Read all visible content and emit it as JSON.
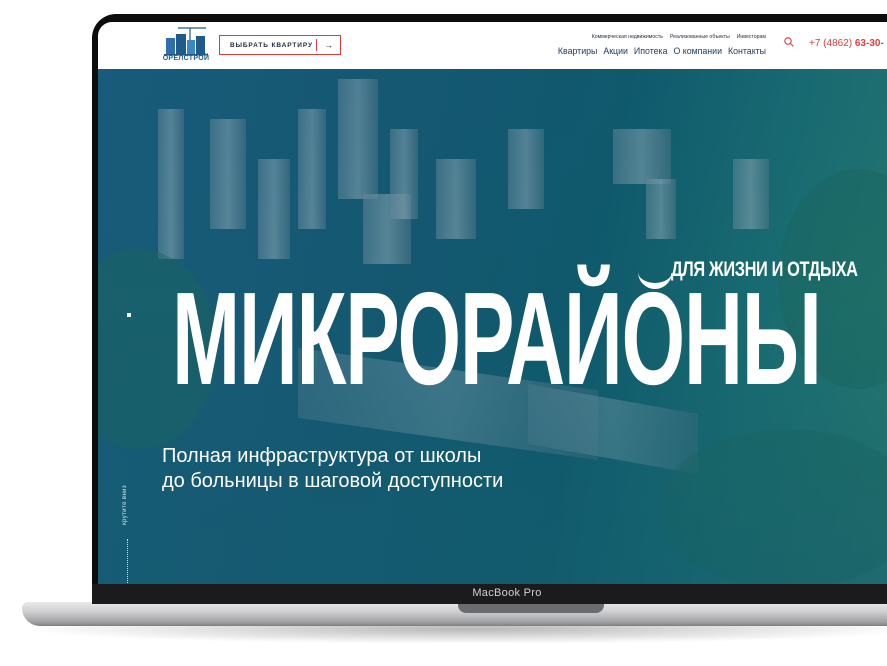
{
  "device": {
    "label": "MacBook Pro"
  },
  "header": {
    "logo_text": "ОРЁЛСТРОЙ",
    "cta_label": "ВЫБРАТЬ КВАРТИРУ",
    "cta_icon": "arrow-right-icon",
    "top_nav": [
      "Коммерческая недвижимость",
      "Реализованные объекты",
      "Инвесторам"
    ],
    "main_nav": [
      "Квартиры",
      "Акции",
      "Ипотека",
      "О компании",
      "Контакты"
    ],
    "phone_prefix": "+7 (4862)",
    "phone_number": "63-30-",
    "search_icon": "search-icon"
  },
  "hero": {
    "subtitle": "ДЛЯ ЖИЗНИ И ОТДЫХА",
    "title": "МИКРОРАЙОНЫ",
    "description_line1": "Полная инфраструктура от школы",
    "description_line2": "до больницы в шаговой доступности",
    "scroll_label": "крутите вниз"
  },
  "colors": {
    "accent": "#e23b3b",
    "brand_blue": "#1e5a8a",
    "hero_teal": "#155a73"
  }
}
